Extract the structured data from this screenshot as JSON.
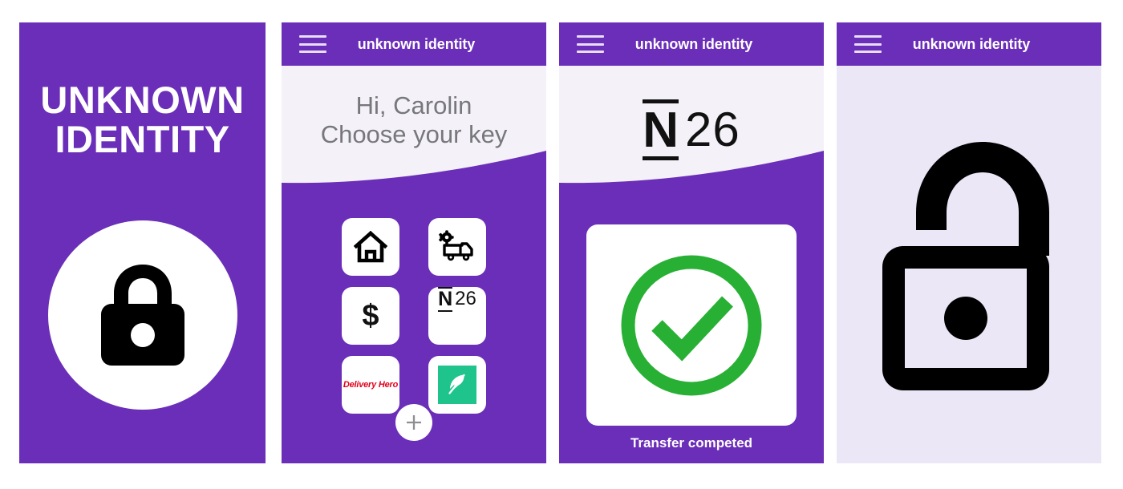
{
  "meta": {
    "brand_purple": "#6b2eb8",
    "light_panel": "#f4f2f8",
    "lavender_panel": "#ebe7f7",
    "success_green": "#27b034",
    "delivery_hero_red": "#e2001a",
    "robinhood_green": "#1fc48c"
  },
  "panels": [
    {
      "id": "splash",
      "title_line_1": "UNKNOWN",
      "title_line_2": "IDENTITY",
      "icon": "lock-closed-icon"
    },
    {
      "id": "choose-key",
      "appbar": {
        "title": "unknown identity",
        "menu_icon": "hamburger-menu-icon"
      },
      "greeting_line_1": "Hi, Carolin",
      "greeting_line_2": "Choose your key",
      "keys": [
        {
          "name": "home",
          "icon": "home-icon",
          "label": ""
        },
        {
          "name": "delivery",
          "icon": "delivery-truck-settings-icon",
          "label": ""
        },
        {
          "name": "money",
          "icon": "dollar-sign-icon",
          "label": "$"
        },
        {
          "name": "n26",
          "icon": "n26-logo-icon",
          "label_mark": "N",
          "label_number": "26"
        },
        {
          "name": "delivery-hero",
          "icon": "delivery-hero-logo-icon",
          "label": "Delivery Hero"
        },
        {
          "name": "robinhood",
          "icon": "robinhood-feather-icon",
          "label": ""
        }
      ],
      "add_button": {
        "icon": "plus-icon"
      }
    },
    {
      "id": "transfer-success",
      "appbar": {
        "title": "unknown identity",
        "menu_icon": "hamburger-menu-icon"
      },
      "logo_mark": "N",
      "logo_number": "26",
      "status_icon": "check-circle-icon",
      "status_text": "Transfer competed"
    },
    {
      "id": "unlocked",
      "appbar": {
        "title": "unknown identity",
        "menu_icon": "hamburger-menu-icon"
      },
      "icon": "lock-open-icon"
    }
  ]
}
